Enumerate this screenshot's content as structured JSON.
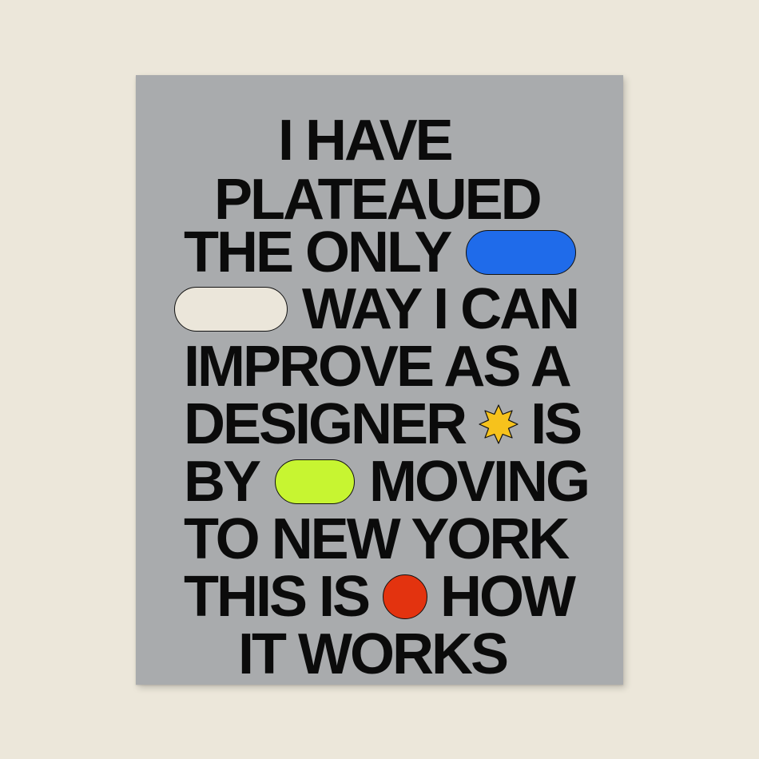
{
  "poster": {
    "lines": [
      "I HAVE",
      "PLATEAUED",
      "THE ONLY",
      "WAY I CAN",
      "IMPROVE AS A",
      "DESIGNER",
      "IS",
      "BY",
      "MOVING",
      "TO NEW YORK",
      "THIS IS",
      "HOW",
      "IT WORKS"
    ],
    "shapes": {
      "blue_pill": "#1f6bea",
      "cream_pill": "#ebe6da",
      "yellow_star": "#f6c21c",
      "lime_pill": "#c7f531",
      "red_dot": "#e3330f"
    }
  },
  "colors": {
    "background": "#ece7da",
    "poster": "#a9abad",
    "text": "#0b0b0b"
  }
}
